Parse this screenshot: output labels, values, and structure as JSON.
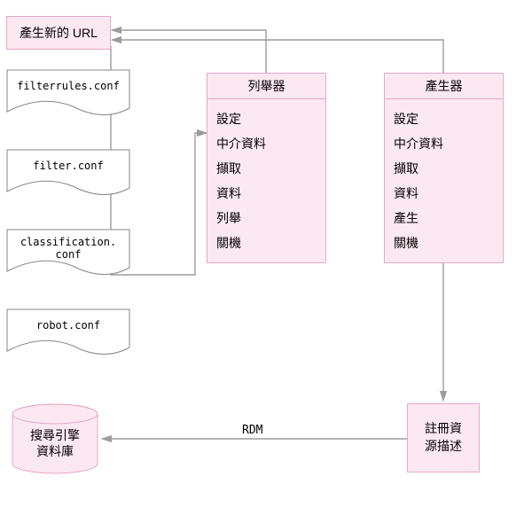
{
  "generate_url": {
    "label": "產生新的 URL"
  },
  "enumerator": {
    "title": "列舉器",
    "items": [
      "設定",
      "中介資料",
      "擷取",
      "資料",
      "列舉",
      "關機"
    ]
  },
  "generator": {
    "title": "產生器",
    "items": [
      "設定",
      "中介資料",
      "擷取",
      "資料",
      "產生",
      "關機"
    ]
  },
  "files": {
    "filterrules": "filterrules.conf",
    "filter": "filter.conf",
    "classification": "classification.\nconf",
    "robot": "robot.conf"
  },
  "rdm_label": "RDM",
  "register_rd": {
    "line1": "註冊資",
    "line2": "源描述"
  },
  "search_db": {
    "line1": "搜尋引擎",
    "line2": "資料庫"
  }
}
